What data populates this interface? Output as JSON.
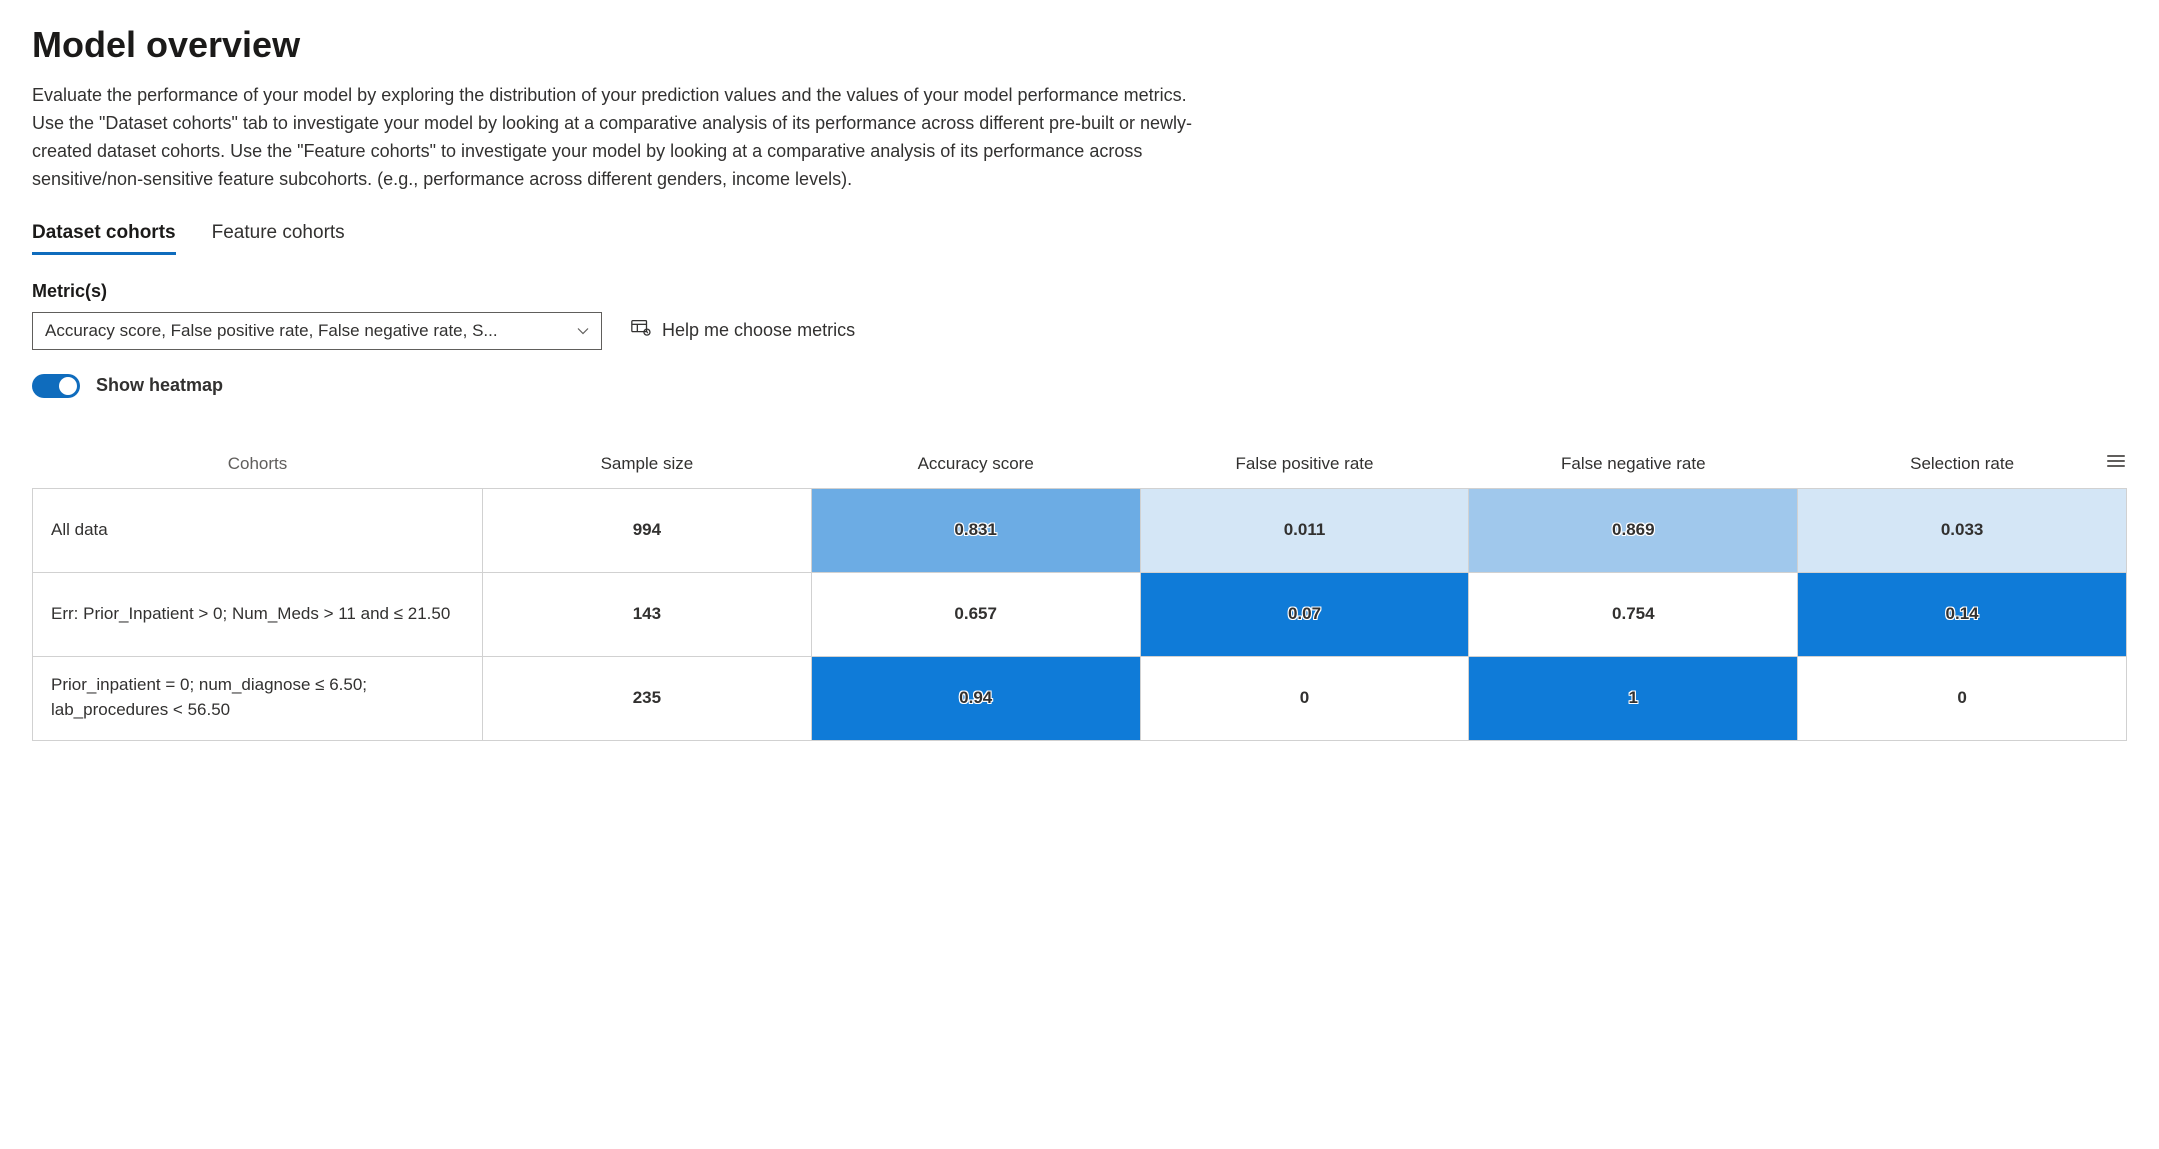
{
  "header": {
    "title": "Model overview",
    "description": "Evaluate the performance of your model by exploring the distribution of your prediction values and the values of your model performance metrics. Use the \"Dataset cohorts\" tab to investigate your model by looking at a comparative analysis of its performance across different pre-built or newly-created dataset cohorts. Use the \"Feature cohorts\" to investigate your model by looking at a comparative analysis of its performance across sensitive/non-sensitive feature subcohorts. (e.g., performance across different genders, income levels)."
  },
  "tabs": [
    {
      "label": "Dataset cohorts",
      "active": true
    },
    {
      "label": "Feature cohorts",
      "active": false
    }
  ],
  "metrics": {
    "label": "Metric(s)",
    "selected_display": "Accuracy score, False positive rate, False negative rate, S...",
    "help_link": "Help me choose metrics"
  },
  "toggle": {
    "label": "Show heatmap",
    "on": true
  },
  "table": {
    "headers": {
      "cohorts": "Cohorts",
      "sample_size": "Sample size",
      "accuracy": "Accuracy score",
      "fpr": "False positive rate",
      "fnr": "False negative rate",
      "selection": "Selection rate"
    },
    "rows": [
      {
        "cohort": "All data",
        "sample_size": "994",
        "accuracy": {
          "value": "0.831",
          "bg": "#6cace4",
          "outlined": true
        },
        "fpr": {
          "value": "0.011",
          "bg": "#d4e6f6",
          "outlined": false
        },
        "fnr": {
          "value": "0.869",
          "bg": "#a0c8ec",
          "outlined": true
        },
        "selection": {
          "value": "0.033",
          "bg": "#d4e6f6",
          "outlined": false
        }
      },
      {
        "cohort": "Err: Prior_Inpatient > 0; Num_Meds > 11 and ≤ 21.50",
        "sample_size": "143",
        "accuracy": {
          "value": "0.657",
          "bg": "#ffffff",
          "outlined": false
        },
        "fpr": {
          "value": "0.07",
          "bg": "#0f7bd8",
          "outlined": true
        },
        "fnr": {
          "value": "0.754",
          "bg": "#ffffff",
          "outlined": false
        },
        "selection": {
          "value": "0.14",
          "bg": "#0f7bd8",
          "outlined": true
        }
      },
      {
        "cohort": "Prior_inpatient = 0; num_diagnose ≤ 6.50; lab_procedures < 56.50",
        "sample_size": "235",
        "accuracy": {
          "value": "0.94",
          "bg": "#0f7bd8",
          "outlined": true
        },
        "fpr": {
          "value": "0",
          "bg": "#ffffff",
          "outlined": false
        },
        "fnr": {
          "value": "1",
          "bg": "#0f7bd8",
          "outlined": true
        },
        "selection": {
          "value": "0",
          "bg": "#ffffff",
          "outlined": false
        }
      }
    ]
  }
}
